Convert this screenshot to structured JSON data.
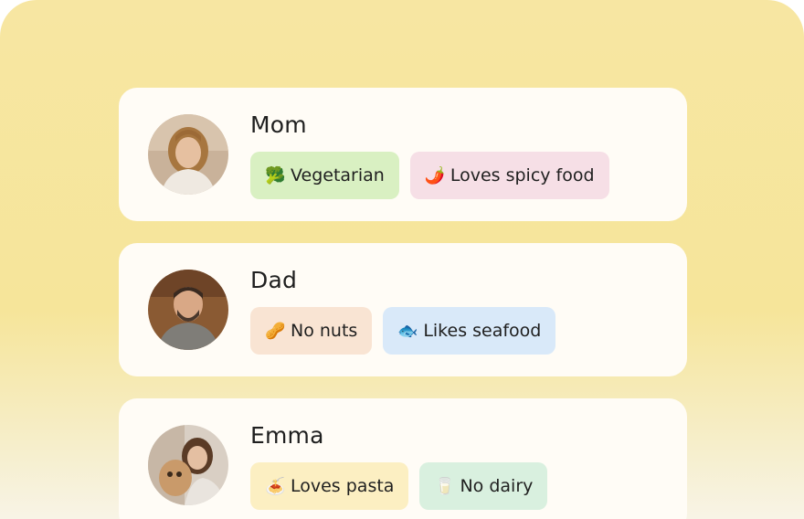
{
  "members": [
    {
      "name": "Mom",
      "avatar": "woman-avatar",
      "tags": [
        {
          "icon": "broccoli-icon",
          "glyph": "🥦",
          "label": "Vegetarian",
          "bg": "#d9f0c2"
        },
        {
          "icon": "chili-pepper-icon",
          "glyph": "🌶️",
          "label": "Loves spicy food",
          "bg": "#f6dfe6"
        }
      ]
    },
    {
      "name": "Dad",
      "avatar": "man-avatar",
      "tags": [
        {
          "icon": "peanut-icon",
          "glyph": "🥜",
          "label": "No nuts",
          "bg": "#f9e4d3"
        },
        {
          "icon": "fish-icon",
          "glyph": "🐟",
          "label": "Likes seafood",
          "bg": "#d9e9f9"
        }
      ]
    },
    {
      "name": "Emma",
      "avatar": "girl-with-dog-avatar",
      "tags": [
        {
          "icon": "pasta-icon",
          "glyph": "🍝",
          "label": "Loves pasta",
          "bg": "#fcefc2"
        },
        {
          "icon": "milk-glass-icon",
          "glyph": "🥛",
          "label": "No dairy",
          "bg": "#d9f0df"
        }
      ]
    }
  ]
}
